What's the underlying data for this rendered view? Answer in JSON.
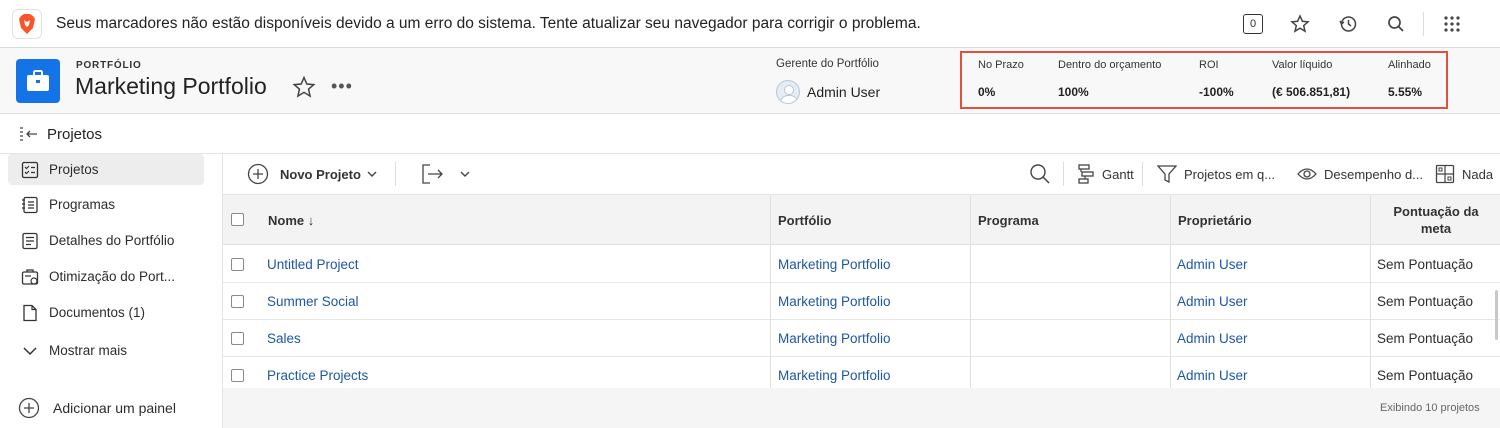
{
  "notice": {
    "message": "Seus marcadores não estão disponíveis devido a um erro do sistema. Tente atualizar seu navegador para corrigir o problema.",
    "counter": "0"
  },
  "header": {
    "kicker": "PORTFÓLIO",
    "title": "Marketing Portfolio",
    "more": "•••",
    "manager_label": "Gerente do Portfólio",
    "manager_name": "Admin User"
  },
  "kpis": [
    {
      "label": "No Prazo",
      "value": "0%"
    },
    {
      "label": "Dentro do orçamento",
      "value": "100%"
    },
    {
      "label": "ROI",
      "value": "-100%"
    },
    {
      "label": "Valor líquido",
      "value": "(€ 506.851,81)"
    },
    {
      "label": "Alinhado",
      "value": "5.55%"
    }
  ],
  "section": {
    "title": "Projetos"
  },
  "sidebar": {
    "items": [
      {
        "label": "Projetos",
        "icon": "projects-icon",
        "active": true
      },
      {
        "label": "Programas",
        "icon": "programs-icon"
      },
      {
        "label": "Detalhes do Portfólio",
        "icon": "details-icon"
      },
      {
        "label": "Otimização do Port...",
        "icon": "optimizer-icon"
      },
      {
        "label": "Documentos (1)",
        "icon": "document-icon"
      },
      {
        "label": "Mostrar mais",
        "icon": "chevron-down-icon"
      }
    ],
    "add_panel": "Adicionar um painel"
  },
  "toolbar": {
    "new_project": "Novo Projeto",
    "gantt": "Gantt",
    "filter": "Projetos em q...",
    "view": "Desempenho d...",
    "grouping": "Nada"
  },
  "table": {
    "columns": {
      "name": "Nome ↓",
      "portfolio": "Portfólio",
      "program": "Programa",
      "owner": "Proprietário",
      "score_l1": "Pontuação da",
      "score_l2": "meta"
    },
    "rows": [
      {
        "name": "Untitled Project",
        "portfolio": "Marketing Portfolio",
        "program": "",
        "owner": "Admin User",
        "score": "Sem Pontuação"
      },
      {
        "name": "Summer Social",
        "portfolio": "Marketing Portfolio",
        "program": "",
        "owner": "Admin User",
        "score": "Sem Pontuação"
      },
      {
        "name": "Sales",
        "portfolio": "Marketing Portfolio",
        "program": "",
        "owner": "Admin User",
        "score": "Sem Pontuação"
      },
      {
        "name": "Practice Projects",
        "portfolio": "Marketing Portfolio",
        "program": "",
        "owner": "Admin User",
        "score": "Sem Pontuação"
      }
    ],
    "footer": "Exibindo 10 projetos"
  },
  "colors": {
    "accent": "#1473e6",
    "link": "#1f57a4",
    "highlight": "#e0513b"
  }
}
